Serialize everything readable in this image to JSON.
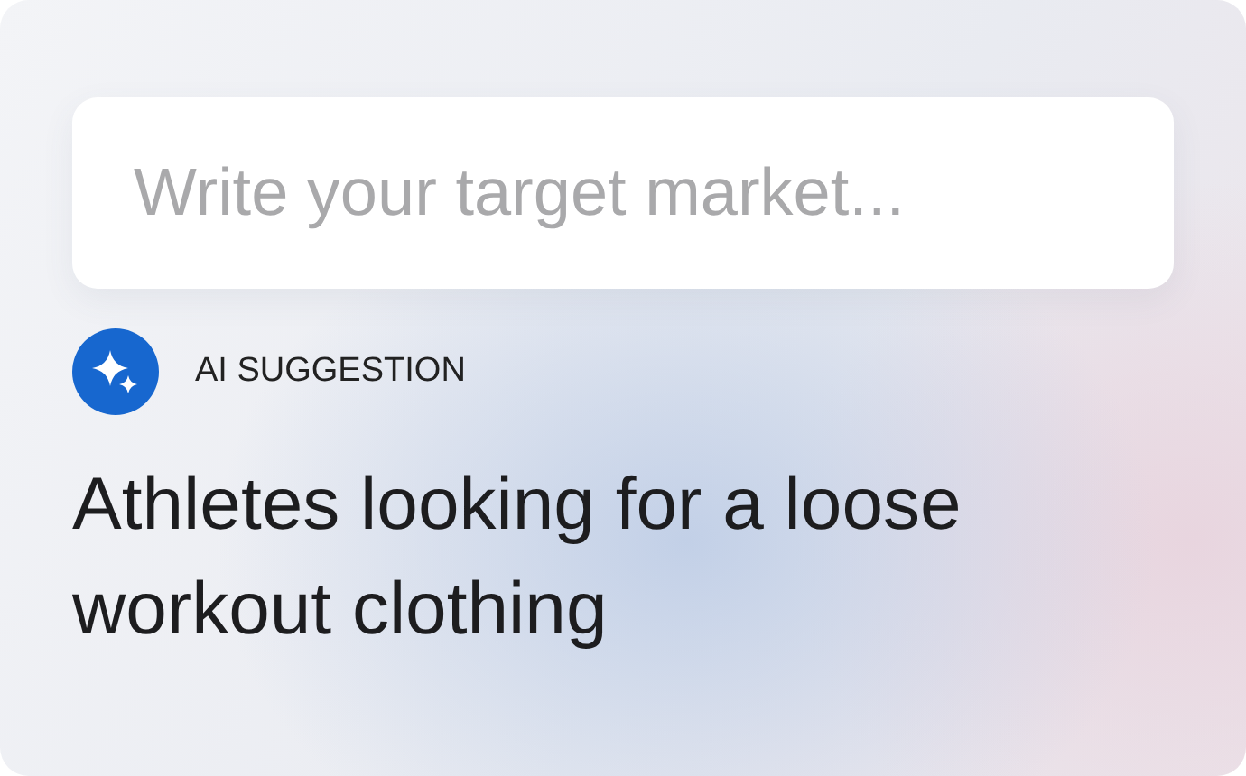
{
  "input": {
    "placeholder": "Write your target market..."
  },
  "suggestion": {
    "label": "AI SUGGESTION",
    "text": "Athletes looking for a loose workout clothing"
  }
}
